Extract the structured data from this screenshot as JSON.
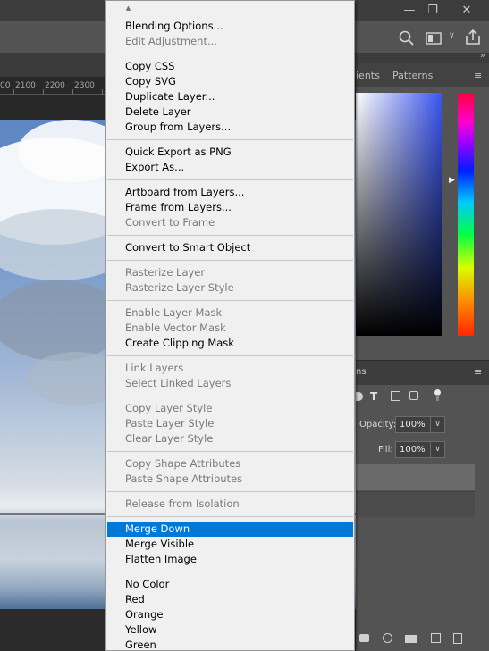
{
  "ruler": {
    "labels": [
      "2100",
      "2200",
      "2300"
    ],
    "partial": "00"
  },
  "panels": {
    "color_tabs": {
      "gradients_partial": "ients",
      "patterns": "Patterns"
    },
    "layers_tab_partial": "ns",
    "opacity": {
      "label": "Opacity:",
      "value": "100%"
    },
    "fill": {
      "label": "Fill:",
      "value": "100%"
    }
  },
  "context_menu": {
    "items": [
      {
        "label": "Blending Options...",
        "enabled": true
      },
      {
        "label": "Edit Adjustment...",
        "enabled": false
      },
      {
        "label": "Copy CSS",
        "enabled": true
      },
      {
        "label": "Copy SVG",
        "enabled": true
      },
      {
        "label": "Duplicate Layer...",
        "enabled": true
      },
      {
        "label": "Delete Layer",
        "enabled": true
      },
      {
        "label": "Group from Layers...",
        "enabled": true
      },
      {
        "label": "Quick Export as PNG",
        "enabled": true
      },
      {
        "label": "Export As...",
        "enabled": true
      },
      {
        "label": "Artboard from Layers...",
        "enabled": true
      },
      {
        "label": "Frame from Layers...",
        "enabled": true
      },
      {
        "label": "Convert to Frame",
        "enabled": false
      },
      {
        "label": "Convert to Smart Object",
        "enabled": true
      },
      {
        "label": "Rasterize Layer",
        "enabled": false
      },
      {
        "label": "Rasterize Layer Style",
        "enabled": false
      },
      {
        "label": "Enable Layer Mask",
        "enabled": false
      },
      {
        "label": "Enable Vector Mask",
        "enabled": false
      },
      {
        "label": "Create Clipping Mask",
        "enabled": true
      },
      {
        "label": "Link Layers",
        "enabled": false
      },
      {
        "label": "Select Linked Layers",
        "enabled": false
      },
      {
        "label": "Copy Layer Style",
        "enabled": false
      },
      {
        "label": "Paste Layer Style",
        "enabled": false
      },
      {
        "label": "Clear Layer Style",
        "enabled": false
      },
      {
        "label": "Copy Shape Attributes",
        "enabled": false
      },
      {
        "label": "Paste Shape Attributes",
        "enabled": false
      },
      {
        "label": "Release from Isolation",
        "enabled": false
      },
      {
        "label": "Merge Down",
        "enabled": true,
        "highlighted": true
      },
      {
        "label": "Merge Visible",
        "enabled": true
      },
      {
        "label": "Flatten Image",
        "enabled": true
      },
      {
        "label": "No Color",
        "enabled": true
      },
      {
        "label": "Red",
        "enabled": true
      },
      {
        "label": "Orange",
        "enabled": true
      },
      {
        "label": "Yellow",
        "enabled": true
      },
      {
        "label": "Green",
        "enabled": true
      }
    ]
  },
  "colors": {
    "menu_highlight": "#0078d7",
    "menu_background": "#f0f0f0",
    "disabled_text": "#7a7a7a",
    "panel_background": "#535353"
  },
  "icons": [
    "minimize-icon",
    "restore-icon",
    "close-icon",
    "search-icon",
    "workspace-icon",
    "share-icon",
    "panel-menu-icon",
    "scroll-up-arrow-icon"
  ]
}
